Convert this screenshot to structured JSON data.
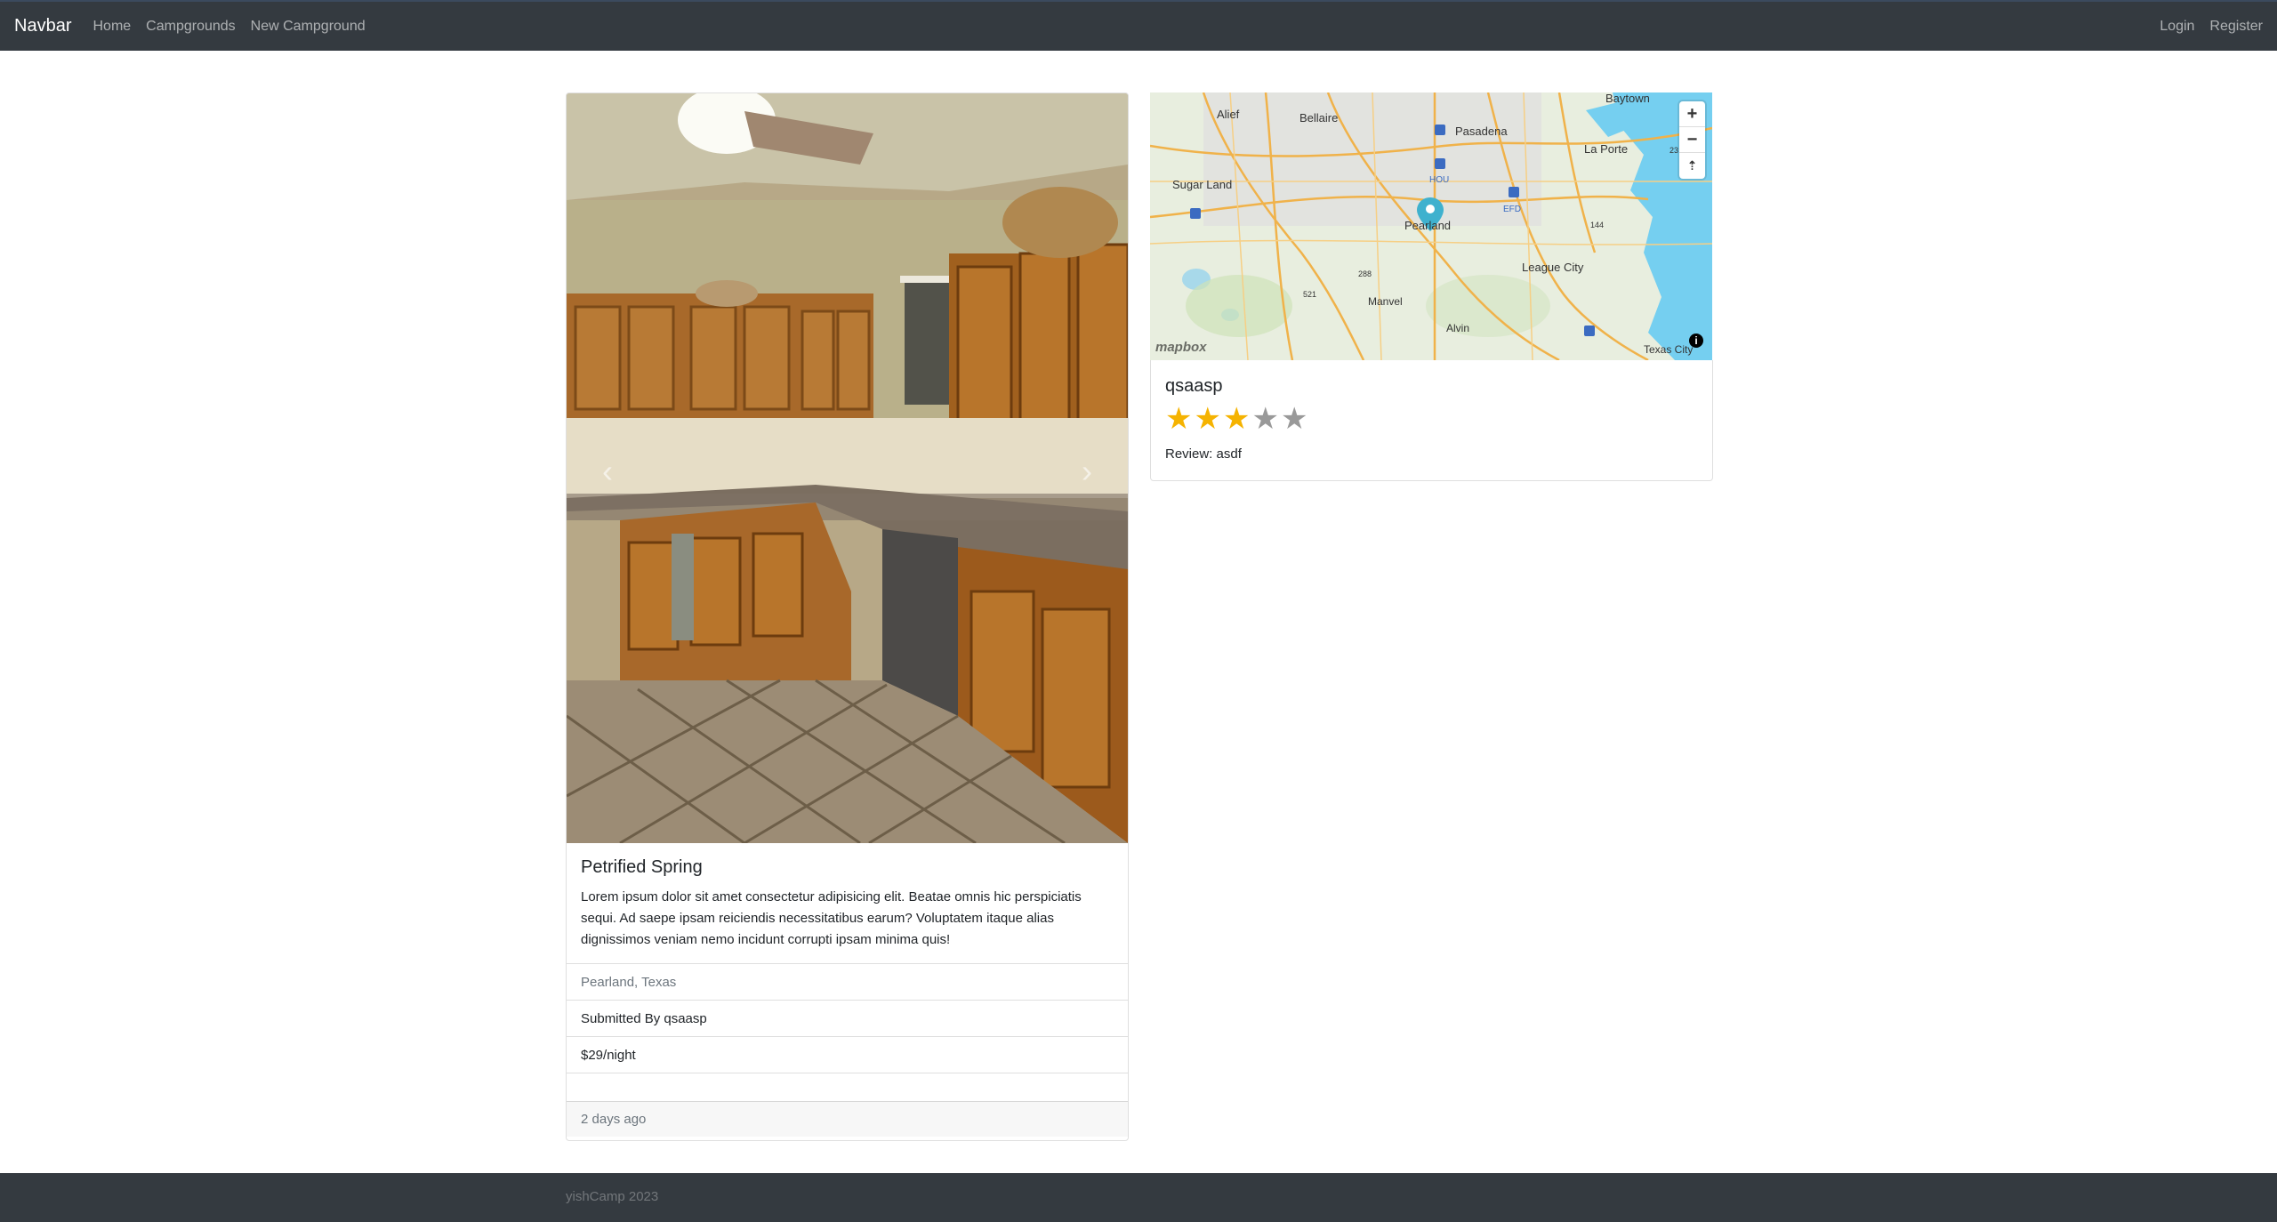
{
  "navbar": {
    "brand": "Navbar",
    "links": [
      "Home",
      "Campgrounds",
      "New Campground"
    ],
    "right_links": [
      "Login",
      "Register"
    ]
  },
  "campground": {
    "title": "Petrified Spring",
    "description": "Lorem ipsum dolor sit amet consectetur adipisicing elit. Beatae omnis hic perspiciatis sequi. Ad saepe ipsam reiciendis necessitatibus earum? Voluptatem itaque alias dignissimos veniam nemo incidunt corrupti ipsam minima quis!",
    "location": "Pearland, Texas",
    "submitted_by": "Submitted By qsaasp",
    "price": "$29/night",
    "posted": "2 days ago",
    "carousel_prev": "‹",
    "carousel_next": "›"
  },
  "map": {
    "labels": [
      "Baytown",
      "Alief",
      "Bellaire",
      "Pasadena",
      "La Porte",
      "Sugar Land",
      "HOU",
      "EFD",
      "Pearland",
      "League City",
      "Manvel",
      "Alvin",
      "Texas City"
    ],
    "zoom_in": "+",
    "zoom_out": "−",
    "compass": "⇡",
    "logo": "mapbox",
    "info": "i"
  },
  "review": {
    "author": "qsaasp",
    "rating": 3,
    "max_rating": 5,
    "text": "Review: asdf"
  },
  "footer": {
    "text": "yishCamp 2023"
  },
  "colors": {
    "navbar_bg": "#343a40",
    "star_on": "#f5b301",
    "star_off": "#999999",
    "marker": "#3fb1ce"
  }
}
